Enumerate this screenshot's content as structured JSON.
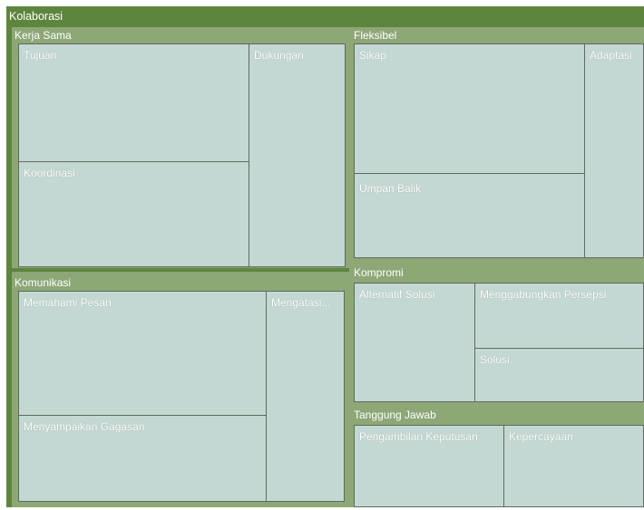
{
  "chart_data": {
    "type": "treemap",
    "title": "Kolaborasi",
    "groups": [
      {
        "name": "Kerja Sama",
        "children": [
          {
            "name": "Tujuan"
          },
          {
            "name": "Koordinasi"
          },
          {
            "name": "Dukungan"
          }
        ]
      },
      {
        "name": "Komunikasi",
        "children": [
          {
            "name": "Memahami Pesan"
          },
          {
            "name": "Menyampaikan Gagasan"
          },
          {
            "name": "Mengatasi..."
          }
        ]
      },
      {
        "name": "Fleksibel",
        "children": [
          {
            "name": "Sikap"
          },
          {
            "name": "Umpan Balik"
          },
          {
            "name": "Adaptasi"
          }
        ]
      },
      {
        "name": "Kompromi",
        "children": [
          {
            "name": "Alternatif Solusi"
          },
          {
            "name": "Menggabungkan Persepsi"
          },
          {
            "name": "Solusi"
          }
        ]
      },
      {
        "name": "Tanggung Jawab",
        "children": [
          {
            "name": "Pengambilan Keputusan"
          },
          {
            "name": "Kepercayaan"
          }
        ]
      }
    ],
    "colors": {
      "root": "#5e853e",
      "group": "#8da777",
      "leaf": "#c4d8d3"
    }
  }
}
